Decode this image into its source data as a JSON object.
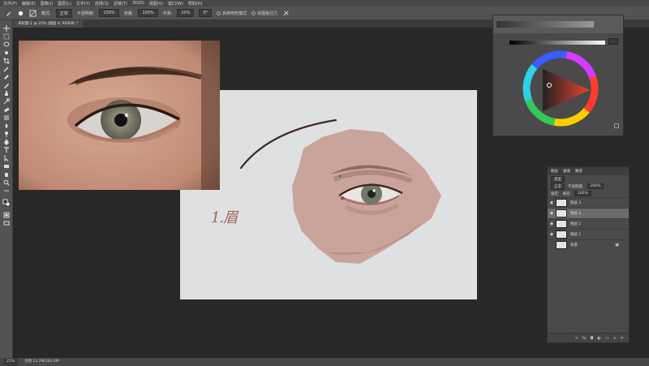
{
  "menu": [
    "文件(F)",
    "编辑(E)",
    "图像(I)",
    "图层(L)",
    "文字(Y)",
    "选择(S)",
    "滤镜(T)",
    "3D(D)",
    "视图(V)",
    "窗口(W)",
    "帮助(H)"
  ],
  "options": {
    "mode_label": "模式:",
    "mode_value": "正常",
    "opacity_label": "不透明度:",
    "opacity_value": "100%",
    "flow_label": "流量:",
    "flow_value": "100%",
    "smoothing_label": "平滑:",
    "smoothing_value": "10%",
    "angle_value": "0°",
    "check1": "启用喷枪模式",
    "check2": "绘图板压力"
  },
  "document": {
    "tab_title": "未标题-1 @ 25% (图层 4, RGB/8) *",
    "sketch_text": "1.眉",
    "zoom": "25%",
    "doc_info": "文档:13.2M/183.6M"
  },
  "layers_panel": {
    "tabs": [
      "图层",
      "通道",
      "路径"
    ],
    "kind_label": "类型",
    "blend_mode": "正常",
    "opacity_label": "不透明度:",
    "opacity_value": "100%",
    "lock_label": "锁定:",
    "fill_label": "填充:",
    "fill_value": "100%",
    "layers": [
      {
        "name": "图层 3",
        "selected": false,
        "visible": true
      },
      {
        "name": "图层 4",
        "selected": true,
        "visible": true
      },
      {
        "name": "图层 2",
        "selected": false,
        "visible": true
      },
      {
        "name": "图层 1",
        "selected": false,
        "visible": true
      },
      {
        "name": "背景",
        "selected": false,
        "visible": false
      }
    ]
  },
  "colors": {
    "workspace": "#282828",
    "panel": "#4a4a4a",
    "canvas_bg": "#dfe0e2",
    "skin_tone": "#c9a49a",
    "iris": "#6d7a6a"
  }
}
